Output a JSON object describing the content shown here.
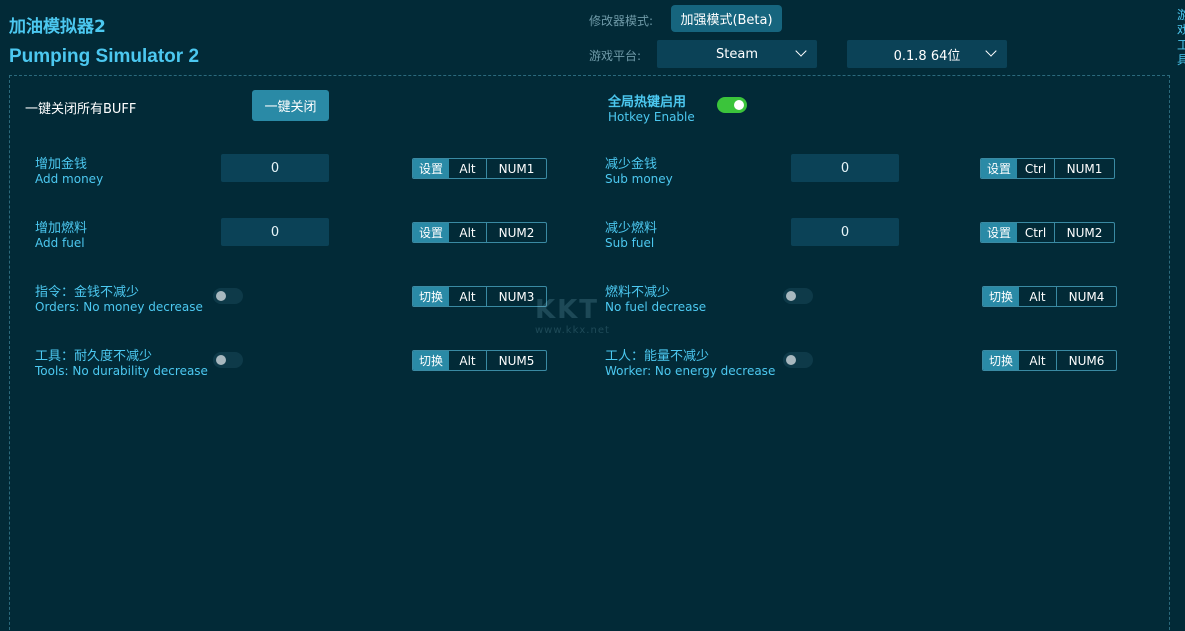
{
  "header": {
    "title_cn": "加油模拟器2",
    "title_en": "Pumping Simulator 2",
    "mode_label": "修改器模式:",
    "mode_value": "加强模式(Beta)",
    "platform_label": "游戏平台:",
    "platform_value": "Steam",
    "version_value": "0.1.8 64位",
    "side_text": "游戏工具"
  },
  "panel": {
    "one_key_label": "一键关闭所有BUFF",
    "one_key_button": "一键关闭",
    "hotkey_cn": "全局热键启用",
    "hotkey_en": "Hotkey Enable",
    "hotkey_enabled": true
  },
  "options": [
    {
      "cn": "增加金钱",
      "en": "Add money",
      "type": "input",
      "value": "0",
      "action": "设置",
      "mod": "Alt",
      "key": "NUM1"
    },
    {
      "cn": "减少金钱",
      "en": "Sub money",
      "type": "input",
      "value": "0",
      "action": "设置",
      "mod": "Ctrl",
      "key": "NUM1"
    },
    {
      "cn": "增加燃料",
      "en": "Add fuel",
      "type": "input",
      "value": "0",
      "action": "设置",
      "mod": "Alt",
      "key": "NUM2"
    },
    {
      "cn": "减少燃料",
      "en": "Sub fuel",
      "type": "input",
      "value": "0",
      "action": "设置",
      "mod": "Ctrl",
      "key": "NUM2"
    },
    {
      "cn": "指令：金钱不减少",
      "en": "Orders: No money decrease",
      "type": "toggle",
      "enabled": false,
      "action": "切换",
      "mod": "Alt",
      "key": "NUM3"
    },
    {
      "cn": "燃料不减少",
      "en": "No fuel decrease",
      "type": "toggle",
      "enabled": false,
      "action": "切换",
      "mod": "Alt",
      "key": "NUM4"
    },
    {
      "cn": "工具：耐久度不减少",
      "en": "Tools: No durability decrease",
      "type": "toggle",
      "enabled": false,
      "action": "切换",
      "mod": "Alt",
      "key": "NUM5"
    },
    {
      "cn": "工人：能量不减少",
      "en": "Worker: No energy decrease",
      "type": "toggle",
      "enabled": false,
      "action": "切换",
      "mod": "Alt",
      "key": "NUM6"
    }
  ],
  "watermark": {
    "logo": "KKT",
    "url": "www.kkx.net"
  },
  "colors": {
    "background": "#022a37",
    "accent": "#4cc8f0",
    "button": "#2a8aa6",
    "toggle_on": "#3bc43b"
  }
}
